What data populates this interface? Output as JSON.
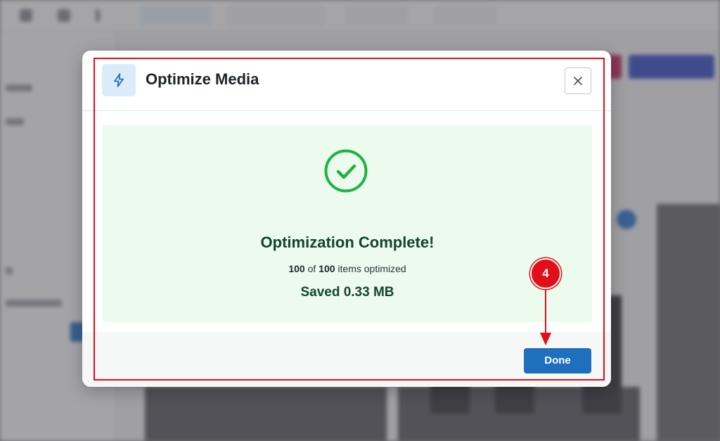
{
  "modal": {
    "title": "Optimize Media",
    "icon": "lightning-bolt-icon",
    "close_icon": "close-icon"
  },
  "result": {
    "icon": "checkmark-circle-icon",
    "title": "Optimization Complete!",
    "optimized_count": "100",
    "of_text": "of",
    "total_count": "100",
    "items_text": "items optimized",
    "saved_text": "Saved 0.33 MB"
  },
  "footer": {
    "done_label": "Done"
  },
  "annotation": {
    "step_number": "4"
  },
  "colors": {
    "accent": "#1e6fbd",
    "success": "#1fb245",
    "success_bg": "#edfbef",
    "annotation_red": "#e10f18"
  }
}
